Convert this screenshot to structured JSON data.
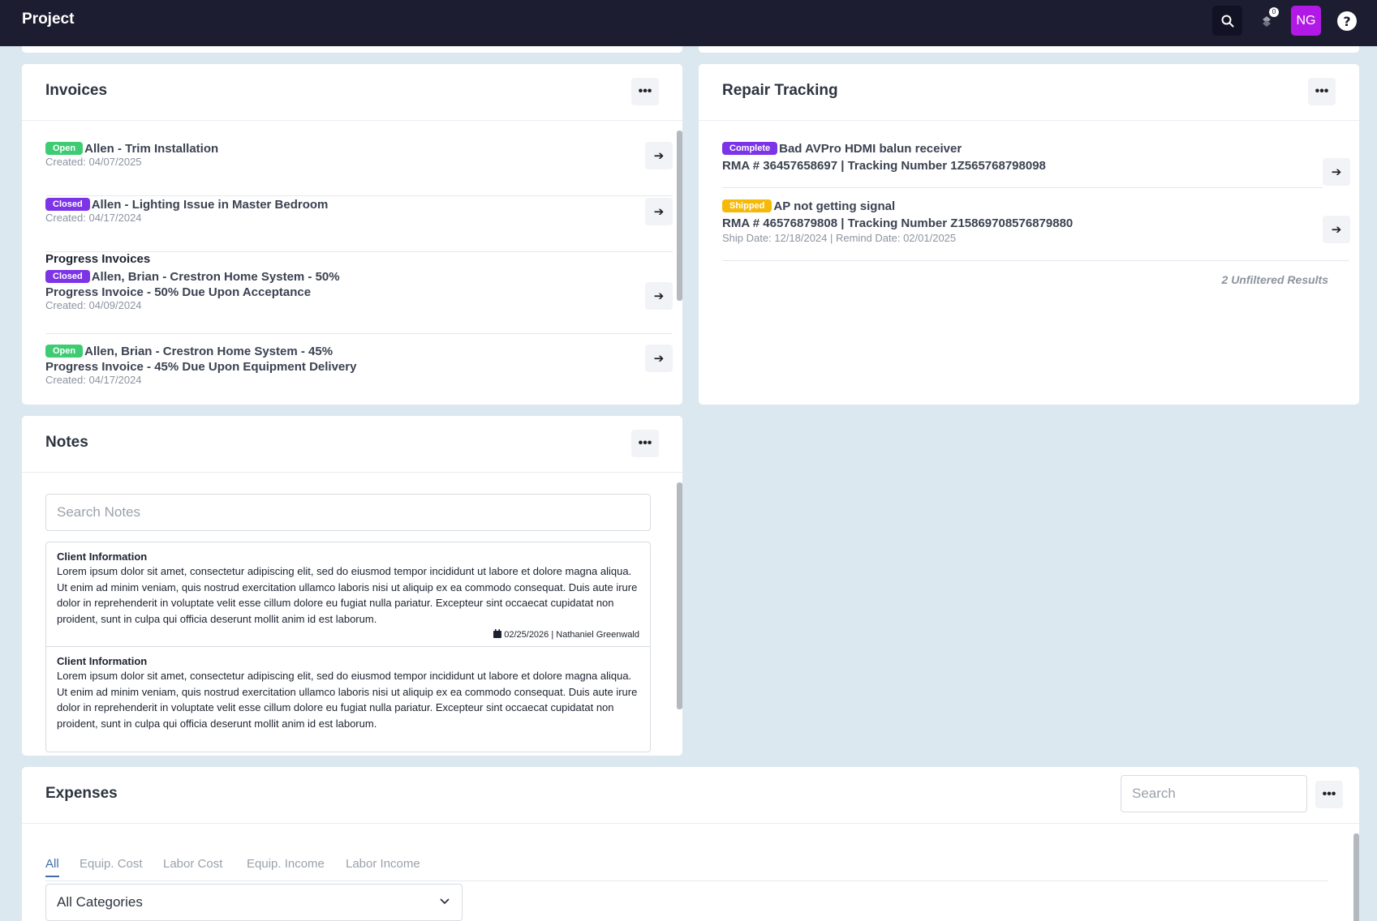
{
  "app": {
    "title": "Project",
    "user_initials": "NG",
    "notification_count": "0"
  },
  "invoices": {
    "title": "Invoices",
    "items": [
      {
        "status": "Open",
        "name": "Allen - Trim Installation",
        "created": "Created: 04/07/2025"
      },
      {
        "status": "Closed",
        "name": "Allen - Lighting Issue in Master Bedroom",
        "created": "Created: 04/17/2024"
      }
    ],
    "progress_title": "Progress Invoices",
    "progress_items": [
      {
        "status": "Closed",
        "name": "Allen, Brian - Crestron Home System - 50%",
        "detail": "Progress Invoice - 50% Due Upon Acceptance",
        "created": "Created: 04/09/2024"
      },
      {
        "status": "Open",
        "name": "Allen, Brian - Crestron Home System - 45%",
        "detail": "Progress Invoice - 45% Due Upon Equipment Delivery",
        "created": "Created: 04/17/2024"
      }
    ]
  },
  "repair": {
    "title": "Repair Tracking",
    "items": [
      {
        "status": "Complete",
        "name": "Bad AVPro HDMI balun receiver",
        "rma": "RMA # 36457658697 | Tracking Number 1Z565768798098"
      },
      {
        "status": "Shipped",
        "name": "AP not getting signal",
        "rma": "RMA # 46576879808 | Tracking Number Z15869708576879880",
        "dates": "Ship Date: 12/18/2024 | Remind Date: 02/01/2025"
      }
    ],
    "results": "2 Unfiltered Results"
  },
  "notes": {
    "title": "Notes",
    "search_placeholder": "Search Notes",
    "items": [
      {
        "title": "Client Information",
        "body": "Lorem ipsum dolor sit amet, consectetur adipiscing elit, sed do eiusmod tempor incididunt ut labore et dolore magna aliqua. Ut enim ad minim veniam, quis nostrud exercitation ullamco laboris nisi ut aliquip ex ea commodo consequat. Duis aute irure dolor in reprehenderit in voluptate velit esse cillum dolore eu fugiat nulla pariatur. Excepteur sint occaecat cupidatat non proident, sunt in culpa qui officia deserunt mollit anim id est laborum.",
        "meta": "02/25/2026 | Nathaniel Greenwald"
      },
      {
        "title": "Client Information",
        "body": "Lorem ipsum dolor sit amet, consectetur adipiscing elit, sed do eiusmod tempor incididunt ut labore et dolore magna aliqua. Ut enim ad minim veniam, quis nostrud exercitation ullamco laboris nisi ut aliquip ex ea commodo consequat. Duis aute irure dolor in reprehenderit in voluptate velit esse cillum dolore eu fugiat nulla pariatur. Excepteur sint occaecat cupidatat non proident, sunt in culpa qui officia deserunt mollit anim id est laborum.",
        "meta": ""
      }
    ]
  },
  "expenses": {
    "title": "Expenses",
    "search_placeholder": "Search",
    "tabs": [
      "All",
      "Equip. Cost",
      "Labor Cost",
      "Equip. Income",
      "Labor Income"
    ],
    "category": "All Categories"
  }
}
